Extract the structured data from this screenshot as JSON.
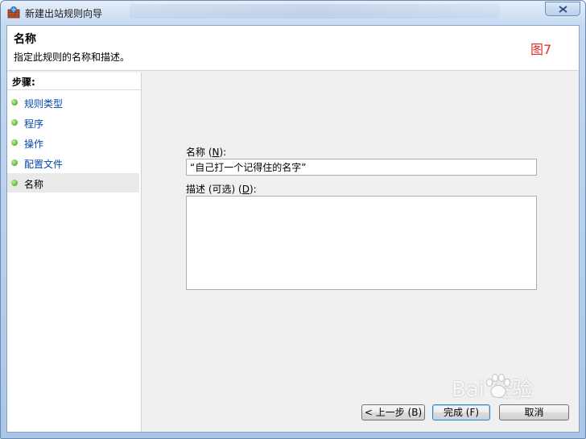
{
  "window": {
    "title": "新建出站规则向导"
  },
  "header": {
    "title": "名称",
    "description": "指定此规则的名称和描述。",
    "annotation": "图7"
  },
  "steps": {
    "heading": "步骤:",
    "items": [
      {
        "label": "规则类型"
      },
      {
        "label": "程序"
      },
      {
        "label": "操作"
      },
      {
        "label": "配置文件"
      },
      {
        "label": "名称"
      }
    ]
  },
  "form": {
    "name_label": "名称 (",
    "name_mnemonic": "N",
    "name_label_end": "):",
    "name_value": "“自己打一个记得住的名字”",
    "desc_label": "描述 (可选) (",
    "desc_mnemonic": "D",
    "desc_label_end": "):",
    "desc_value": ""
  },
  "buttons": {
    "back": "< 上一步 (B)",
    "finish": "完成 (F)",
    "cancel": "取消"
  },
  "watermark": {
    "text": "Bai 经验"
  },
  "colors": {
    "accent_link": "#0645ad",
    "annotation": "#e0312b",
    "step_dot": "#3c9a1c"
  }
}
